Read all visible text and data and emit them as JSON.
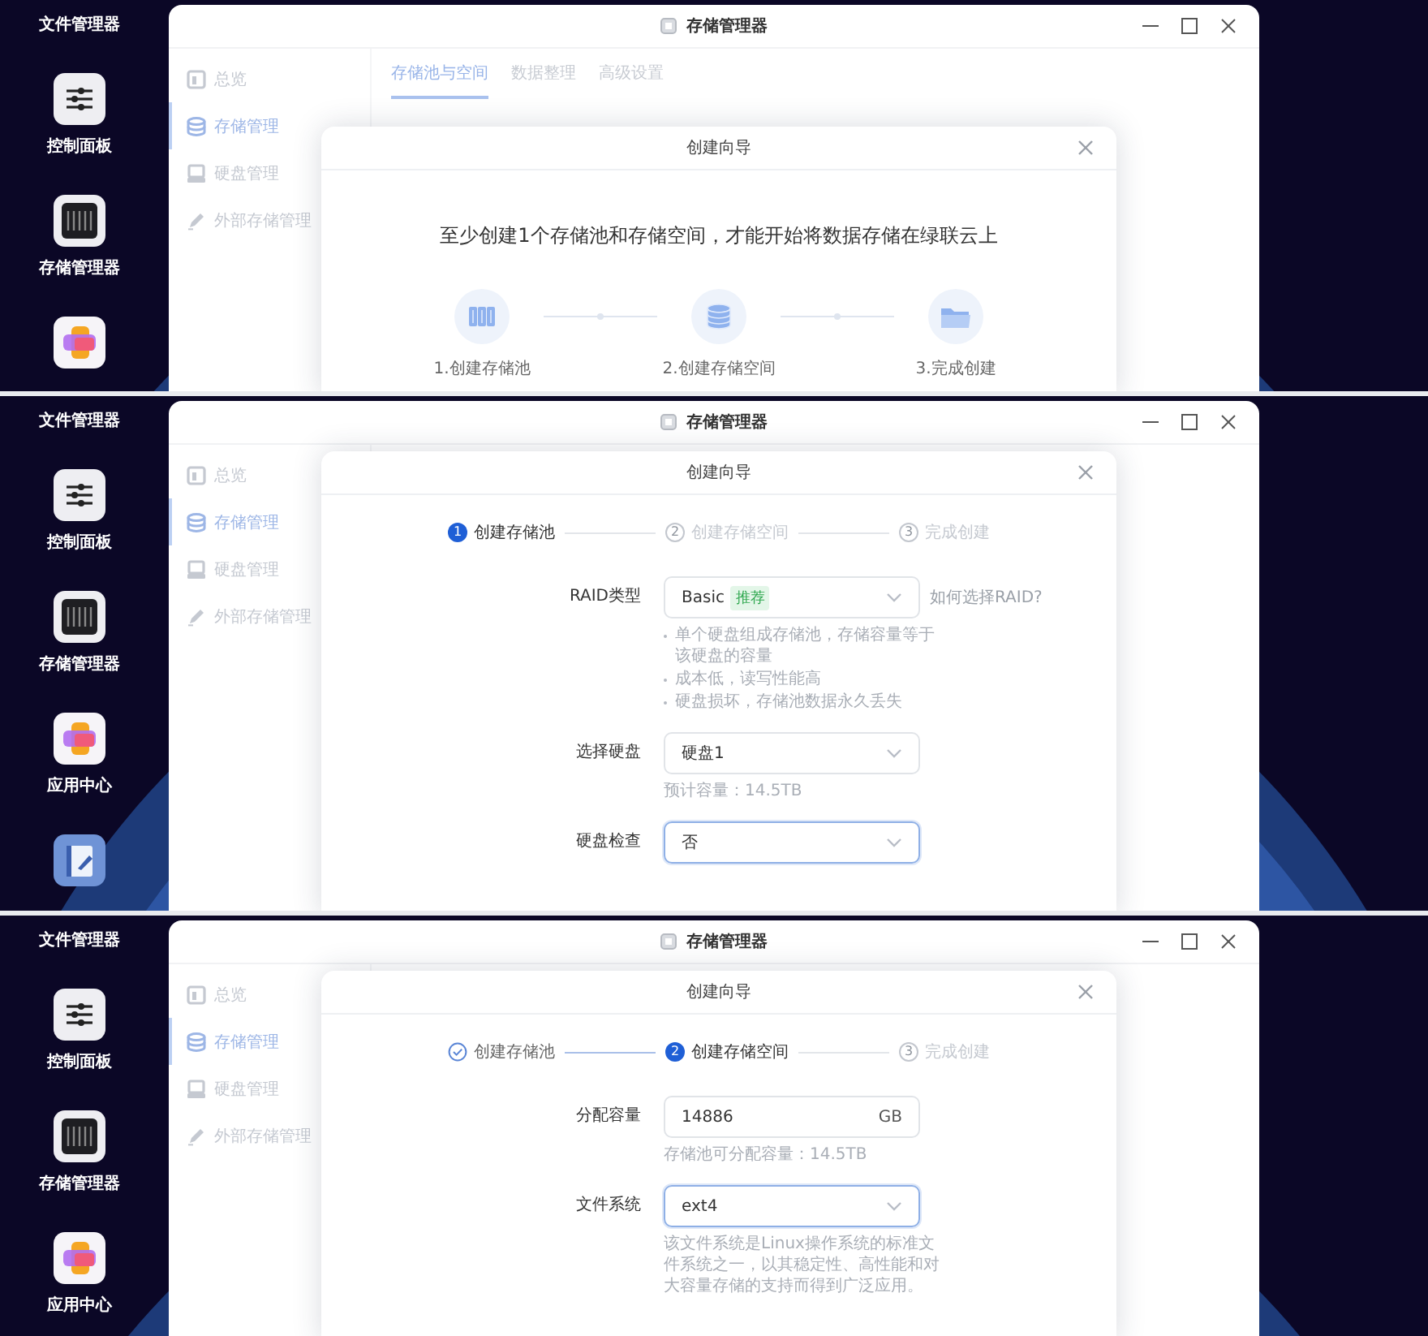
{
  "panels": [
    {
      "desktop": [
        {
          "kind": "label",
          "label": "文件管理器"
        },
        {
          "kind": "sliders",
          "label": "控制面板"
        },
        {
          "kind": "storage",
          "label": "存储管理器"
        },
        {
          "kind": "apps"
        }
      ],
      "window": {
        "title": "存储管理器",
        "sidebar": [
          {
            "label": "总览",
            "selected": false
          },
          {
            "label": "存储管理",
            "selected": true
          },
          {
            "label": "硬盘管理",
            "selected": false
          },
          {
            "label": "外部存储管理",
            "selected": false
          }
        ],
        "tabs": [
          {
            "label": "存储池与空间",
            "selected": true
          },
          {
            "label": "数据整理",
            "selected": false
          },
          {
            "label": "高级设置",
            "selected": false
          }
        ]
      },
      "dialog": {
        "title": "创建向导",
        "kind": "intro",
        "message": "至少创建1个存储池和存储空间，才能开始将数据存储在绿联云上",
        "steps": [
          {
            "label": "1.创建存储池"
          },
          {
            "label": "2.创建存储空间"
          },
          {
            "label": "3.完成创建"
          }
        ]
      }
    },
    {
      "desktop": [
        {
          "kind": "label",
          "label": "文件管理器"
        },
        {
          "kind": "sliders",
          "label": "控制面板"
        },
        {
          "kind": "storage",
          "label": "存储管理器"
        },
        {
          "kind": "apps",
          "label": "应用中心"
        },
        {
          "kind": "notes"
        }
      ],
      "window": {
        "title": "存储管理器",
        "sidebar": [
          {
            "label": "总览",
            "selected": false
          },
          {
            "label": "存储管理",
            "selected": true
          },
          {
            "label": "硬盘管理",
            "selected": false
          },
          {
            "label": "外部存储管理",
            "selected": false
          }
        ]
      },
      "dialog": {
        "title": "创建向导",
        "kind": "form",
        "stepper": [
          {
            "done": false,
            "current": true,
            "number": "1",
            "label": "创建存储池"
          },
          {
            "done": false,
            "current": false,
            "number": "2",
            "label": "创建存储空间"
          },
          {
            "done": false,
            "current": false,
            "number": "3",
            "label": "完成创建"
          }
        ],
        "fields": [
          {
            "kind": "select",
            "label": "RAID类型",
            "value": "Basic",
            "tag": "推荐",
            "link": "如何选择RAID?",
            "focused": false,
            "hints": [
              "单个硬盘组成存储池，存储容量等于该硬盘的容量",
              "成本低，读写性能高",
              "硬盘损坏，存储池数据永久丢失"
            ]
          },
          {
            "kind": "select",
            "label": "选择硬盘",
            "value": "硬盘1",
            "focused": false,
            "note": "预计容量：14.5TB"
          },
          {
            "kind": "select",
            "label": "硬盘检查",
            "value": "否",
            "focused": true
          }
        ]
      }
    },
    {
      "desktop": [
        {
          "kind": "label",
          "label": "文件管理器"
        },
        {
          "kind": "sliders",
          "label": "控制面板"
        },
        {
          "kind": "storage",
          "label": "存储管理器"
        },
        {
          "kind": "apps",
          "label": "应用中心"
        }
      ],
      "window": {
        "title": "存储管理器",
        "sidebar": [
          {
            "label": "总览",
            "selected": false
          },
          {
            "label": "存储管理",
            "selected": true
          },
          {
            "label": "硬盘管理",
            "selected": false
          },
          {
            "label": "外部存储管理",
            "selected": false
          }
        ]
      },
      "dialog": {
        "title": "创建向导",
        "kind": "form",
        "stepper": [
          {
            "done": true,
            "current": false,
            "label": "创建存储池"
          },
          {
            "done": false,
            "current": true,
            "number": "2",
            "label": "创建存储空间"
          },
          {
            "done": false,
            "current": false,
            "number": "3",
            "label": "完成创建"
          }
        ],
        "fields": [
          {
            "kind": "input",
            "label": "分配容量",
            "value": "14886",
            "unit": "GB",
            "focused": false,
            "note": "存储池可分配容量：14.5TB"
          },
          {
            "kind": "select",
            "label": "文件系统",
            "value": "ext4",
            "focused": true,
            "note": "该文件系统是Linux操作系统的标准文件系统之一，以其稳定性、高性能和对大容量存储的支持而得到广泛应用。"
          }
        ]
      }
    }
  ]
}
